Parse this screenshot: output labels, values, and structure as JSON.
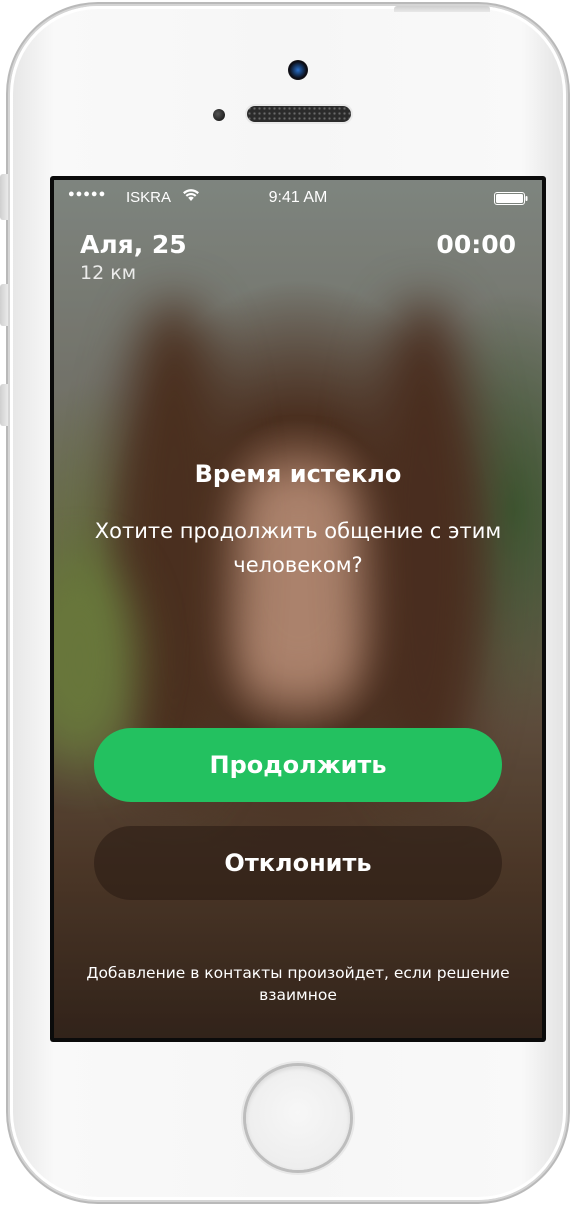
{
  "status_bar": {
    "signal": "●●●●●",
    "carrier": "ISKRA",
    "time": "9:41 AM"
  },
  "profile": {
    "name_age": "Аля, 25",
    "distance": "12 км",
    "timer": "00:00"
  },
  "dialog": {
    "title": "Время истекло",
    "question": "Хотите продолжить общение с этим человеком?"
  },
  "buttons": {
    "continue_label": "Продолжить",
    "decline_label": "Отклонить"
  },
  "footnote": "Добавление в контакты произойдет, если решение взаимное",
  "colors": {
    "accent": "#23c160",
    "decline_bg": "#3a271c",
    "text": "#ffffff"
  },
  "icons": {
    "wifi": "wifi-icon",
    "battery": "battery-icon",
    "camera": "front-camera-icon",
    "home": "home-button"
  }
}
